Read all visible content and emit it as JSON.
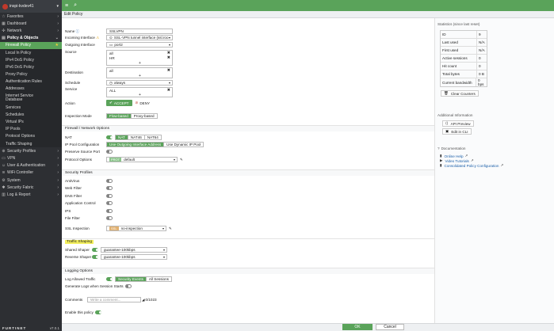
{
  "sidebar": {
    "device": "inspi-kvdev41",
    "items": [
      {
        "label": "Favorites",
        "icon": "star-icon"
      },
      {
        "label": "Dashboard",
        "icon": "dashboard-icon"
      },
      {
        "label": "Network",
        "icon": "network-icon"
      },
      {
        "label": "Policy & Objects",
        "icon": "policy-icon"
      },
      {
        "label": "Firewall Policy"
      },
      {
        "label": "Local In Policy"
      },
      {
        "label": "IPv4 DoS Policy"
      },
      {
        "label": "IPv6 DoS Policy"
      },
      {
        "label": "Proxy Policy"
      },
      {
        "label": "Authentication Rules"
      },
      {
        "label": "Addresses"
      },
      {
        "label": "Internet Service Database"
      },
      {
        "label": "Services"
      },
      {
        "label": "Schedules"
      },
      {
        "label": "Virtual IPs"
      },
      {
        "label": "IP Pools"
      },
      {
        "label": "Protocol Options"
      },
      {
        "label": "Traffic Shaping"
      },
      {
        "label": "Security Profiles",
        "icon": "lock-icon"
      },
      {
        "label": "VPN",
        "icon": "vpn-icon"
      },
      {
        "label": "User & Authentication",
        "icon": "user-icon"
      },
      {
        "label": "WiFi Controller",
        "icon": "wifi-icon"
      },
      {
        "label": "System",
        "icon": "gear-icon"
      },
      {
        "label": "Security Fabric",
        "icon": "fabric-icon"
      },
      {
        "label": "Log & Report",
        "icon": "chart-icon"
      }
    ],
    "brand": "FURTINET",
    "version": "v7.0.1"
  },
  "page_title": "Edit Policy",
  "form": {
    "name_label": "Name",
    "name_value": "SSLVPN",
    "incoming_label": "Incoming Interface",
    "incoming_value": "SSL-VPN tunnel interface (ssl.roo",
    "outgoing_label": "Outgoing Interface",
    "outgoing_value": "port2",
    "source_label": "Source",
    "source_values": [
      "all",
      "HR"
    ],
    "destination_label": "Destination",
    "destination_values": [
      "all"
    ],
    "schedule_label": "Schedule",
    "schedule_value": "always",
    "service_label": "Service",
    "service_values": [
      "ALL"
    ],
    "action_label": "Action",
    "accept_label": "ACCEPT",
    "deny_label": "DENY",
    "inspection_label": "Inspection Mode",
    "flow_label": "Flow-based",
    "proxy_label": "Proxy-based",
    "fw_section": "Firewall / Network Options",
    "nat_label": "NAT",
    "nat_options": [
      "NAT",
      "NAT46",
      "NAT64"
    ],
    "ippool_label": "IP Pool Configuration",
    "ippool_options": [
      "Use Outgoing Interface Address",
      "Use Dynamic IP Pool"
    ],
    "preserve_label": "Preserve Source Port",
    "protocol_label": "Protocol Options",
    "protocol_tag": "PROT",
    "protocol_value": "default",
    "sec_section": "Security Profiles",
    "profiles": [
      "AntiVirus",
      "Web Filter",
      "DNS Filter",
      "Application Control",
      "IPS",
      "File Filter"
    ],
    "ssl_label": "SSL Inspection",
    "ssl_tag": "SSL",
    "ssl_value": "no-inspection",
    "shaping_section": "Traffic Shaping",
    "shared_label": "Shared Shaper",
    "shared_value": "guarantee-100kbps",
    "reverse_label": "Reverse Shaper",
    "reverse_value": "guarantee-100kbps",
    "logging_section": "Logging Options",
    "log_label": "Log Allowed Traffic",
    "log_options": [
      "Security Events",
      "All Sessions"
    ],
    "gen_logs_label": "Generate Logs when Session Starts",
    "comments_label": "Comments",
    "comments_placeholder": "Write a comment...",
    "comments_count": "0/1023",
    "enable_label": "Enable this policy"
  },
  "right": {
    "stats_title": "Statistics (since last reset)",
    "stats": [
      {
        "k": "ID",
        "v": "9"
      },
      {
        "k": "Last used",
        "v": "N/A"
      },
      {
        "k": "First used",
        "v": "N/A"
      },
      {
        "k": "Active sessions",
        "v": "0"
      },
      {
        "k": "Hit count",
        "v": "0"
      },
      {
        "k": "Total bytes",
        "v": "0 B"
      },
      {
        "k": "Current bandwidth",
        "v": "0 bps"
      }
    ],
    "clear_label": "Clear Counters",
    "addl_title": "Additional Information",
    "api_label": "API Preview",
    "cli_label": "Edit in CLI",
    "doc_title": "Documentation",
    "docs": [
      "Online Help",
      "Video Tutorials",
      "Consolidated Policy Configuration"
    ]
  },
  "footer": {
    "ok_label": "OK",
    "cancel_label": "Cancel"
  },
  "colors": {
    "accent": "#5aa35a",
    "sidebar": "#2d2f33"
  }
}
